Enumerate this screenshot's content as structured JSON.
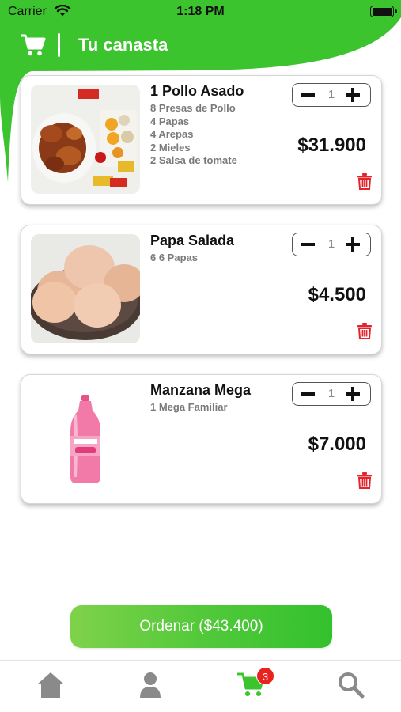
{
  "status_bar": {
    "carrier": "Carrier",
    "time": "1:18 PM"
  },
  "header": {
    "title": "Tu canasta",
    "icon": "cart-icon"
  },
  "colors": {
    "brand_green": "#3cc42f",
    "danger_red": "#e4232a"
  },
  "cart": {
    "items": [
      {
        "name": "1 Pollo Asado",
        "description": [
          "8 Presas de Pollo",
          "4 Papas",
          "4 Arepas",
          "2 Mieles",
          "2 Salsa de tomate"
        ],
        "quantity": "1",
        "price": "$31.900"
      },
      {
        "name": "Papa Salada",
        "description": [
          "6 6 Papas"
        ],
        "quantity": "1",
        "price": "$4.500"
      },
      {
        "name": "Manzana Mega",
        "description": [
          "1 Mega Familiar"
        ],
        "quantity": "1",
        "price": "$7.000"
      }
    ]
  },
  "order_button": {
    "label": "Ordenar ($43.400)"
  },
  "tabbar": {
    "tabs": [
      {
        "icon": "home-icon",
        "active": false
      },
      {
        "icon": "profile-icon",
        "active": false
      },
      {
        "icon": "cart-icon",
        "active": true,
        "badge": "3"
      },
      {
        "icon": "search-icon",
        "active": false
      }
    ]
  }
}
